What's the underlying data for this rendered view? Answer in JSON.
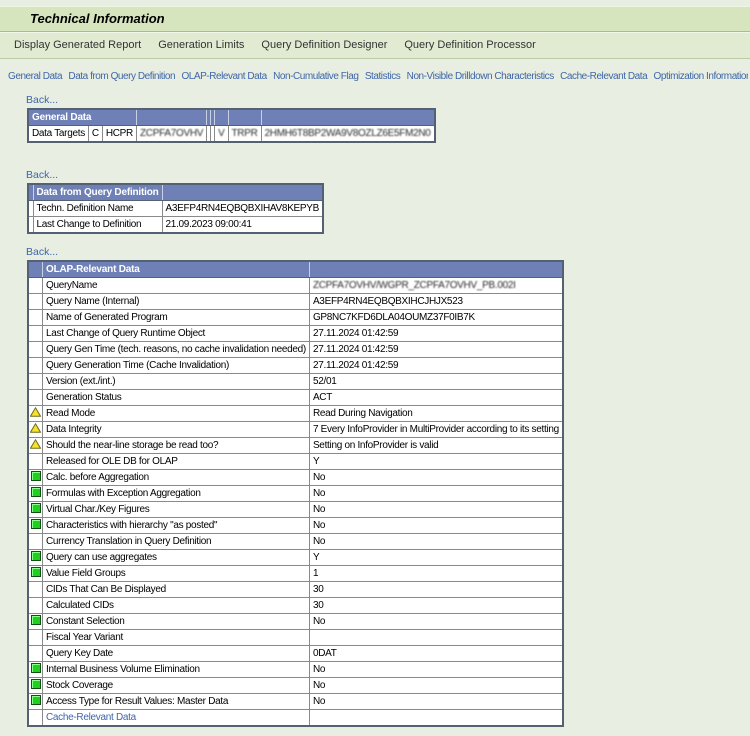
{
  "title": "Technical Information",
  "back_label": "Back...",
  "toolbar": {
    "items": [
      "Display Generated Report",
      "Generation Limits",
      "Query Definition Designer",
      "Query Definition Processor"
    ]
  },
  "nav_links": [
    "General Data",
    "Data from Query Definition",
    "OLAP-Relevant Data",
    "Non-Cumulative Flag",
    "Statistics",
    "Non-Visible Drilldown Characteristics",
    "Cache-Relevant Data",
    "Optimization Information"
  ],
  "general_data": {
    "header": "General Data",
    "row": [
      {
        "text": "Data Targets",
        "redacted": false
      },
      {
        "text": "C",
        "redacted": false
      },
      {
        "text": "HCPR",
        "redacted": false
      },
      {
        "text": "ZCPFA7OVHV",
        "redacted": true
      },
      {
        "text": "",
        "redacted": false
      },
      {
        "text": "",
        "redacted": false
      },
      {
        "text": "V",
        "redacted": true
      },
      {
        "text": "TRPR",
        "redacted": true
      },
      {
        "text": "2HMH6T8BP2WA9V8OZLZ6E5FM2N0",
        "redacted": true
      }
    ]
  },
  "query_definition": {
    "header": "Data from Query Definition",
    "rows": [
      {
        "label": "Techn. Definition Name",
        "value": "A3EFP4RN4EQBQBXIHAV8KEPYB"
      },
      {
        "label": "Last Change to Definition",
        "value": "21.09.2023 09:00:41"
      }
    ]
  },
  "olap": {
    "header": "OLAP-Relevant Data",
    "rows": [
      {
        "icon": "none",
        "label": "QueryName",
        "value": "ZCPFA7OVHV/WGPR_ZCPFA7OVHV_PB.002I",
        "redacted": true,
        "link": false
      },
      {
        "icon": "none",
        "label": "Query Name (Internal)",
        "value": "A3EFP4RN4EQBQBXIHCJHJX523",
        "redacted": false,
        "link": false
      },
      {
        "icon": "none",
        "label": "Name of Generated Program",
        "value": "GP8NC7KFD6DLA04OUMZ37F0IB7K",
        "redacted": false,
        "link": false
      },
      {
        "icon": "none",
        "label": "Last Change of Query Runtime Object",
        "value": "27.11.2024 01:42:59",
        "redacted": false,
        "link": false
      },
      {
        "icon": "none",
        "label": "Query Gen Time (tech. reasons, no cache invalidation needed)",
        "value": "27.11.2024 01:42:59",
        "redacted": false,
        "link": false
      },
      {
        "icon": "none",
        "label": "Query Generation Time (Cache Invalidation)",
        "value": "27.11.2024 01:42:59",
        "redacted": false,
        "link": false
      },
      {
        "icon": "none",
        "label": "Version (ext./int.)",
        "value": "52/01",
        "redacted": false,
        "link": false
      },
      {
        "icon": "none",
        "label": "Generation Status",
        "value": "ACT",
        "redacted": false,
        "link": false
      },
      {
        "icon": "warning",
        "label": "Read Mode",
        "value": "Read During Navigation",
        "redacted": false,
        "link": false
      },
      {
        "icon": "warning",
        "label": "Data Integrity",
        "value": "7 Every InfoProvider in MultiProvider according to its setting",
        "redacted": false,
        "link": false
      },
      {
        "icon": "warning",
        "label": "Should the near-line storage be read too?",
        "value": "Setting on InfoProvider is valid",
        "redacted": false,
        "link": false
      },
      {
        "icon": "none",
        "label": "Released for OLE DB for OLAP",
        "value": "Y",
        "redacted": false,
        "link": false
      },
      {
        "icon": "green",
        "label": "Calc. before Aggregation",
        "value": "No",
        "redacted": false,
        "link": false
      },
      {
        "icon": "green",
        "label": "Formulas with Exception Aggregation",
        "value": "No",
        "redacted": false,
        "link": false
      },
      {
        "icon": "green",
        "label": "Virtual Char./Key Figures",
        "value": "No",
        "redacted": false,
        "link": false
      },
      {
        "icon": "green",
        "label": "Characteristics with hierarchy \"as posted\"",
        "value": "No",
        "redacted": false,
        "link": false
      },
      {
        "icon": "none",
        "label": "Currency Translation in Query Definition",
        "value": "No",
        "redacted": false,
        "link": false
      },
      {
        "icon": "green",
        "label": "Query can use aggregates",
        "value": "Y",
        "redacted": false,
        "link": false
      },
      {
        "icon": "green",
        "label": "Value Field Groups",
        "value": "1",
        "redacted": false,
        "link": false
      },
      {
        "icon": "none",
        "label": "CIDs That Can Be Displayed",
        "value": "30",
        "redacted": false,
        "link": false
      },
      {
        "icon": "none",
        "label": "Calculated CIDs",
        "value": "30",
        "redacted": false,
        "link": false
      },
      {
        "icon": "green",
        "label": "Constant Selection",
        "value": "No",
        "redacted": false,
        "link": false
      },
      {
        "icon": "none",
        "label": "Fiscal Year Variant",
        "value": "",
        "redacted": false,
        "link": false
      },
      {
        "icon": "none",
        "label": "Query Key Date",
        "value": "0DAT",
        "redacted": false,
        "link": false
      },
      {
        "icon": "green",
        "label": "Internal Business Volume Elimination",
        "value": "No",
        "redacted": false,
        "link": false
      },
      {
        "icon": "green",
        "label": "Stock Coverage",
        "value": "No",
        "redacted": false,
        "link": false
      },
      {
        "icon": "green",
        "label": "Access Type for Result Values: Master Data",
        "value": "No",
        "redacted": false,
        "link": false
      },
      {
        "icon": "none",
        "label": "Cache-Relevant Data",
        "value": "",
        "redacted": false,
        "link": true
      }
    ]
  },
  "colors": {
    "title_bar": "#d7e5be",
    "toolbar": "#e1ebd2",
    "page_bg": "#e8eee1",
    "table_header": "#6e80b5",
    "link_blue": "#3e66a8",
    "status_green": "#1fd11f",
    "warning_yellow": "#f8e02c"
  },
  "icons": {
    "warning": "warning-triangle-icon",
    "green": "green-status-icon"
  }
}
